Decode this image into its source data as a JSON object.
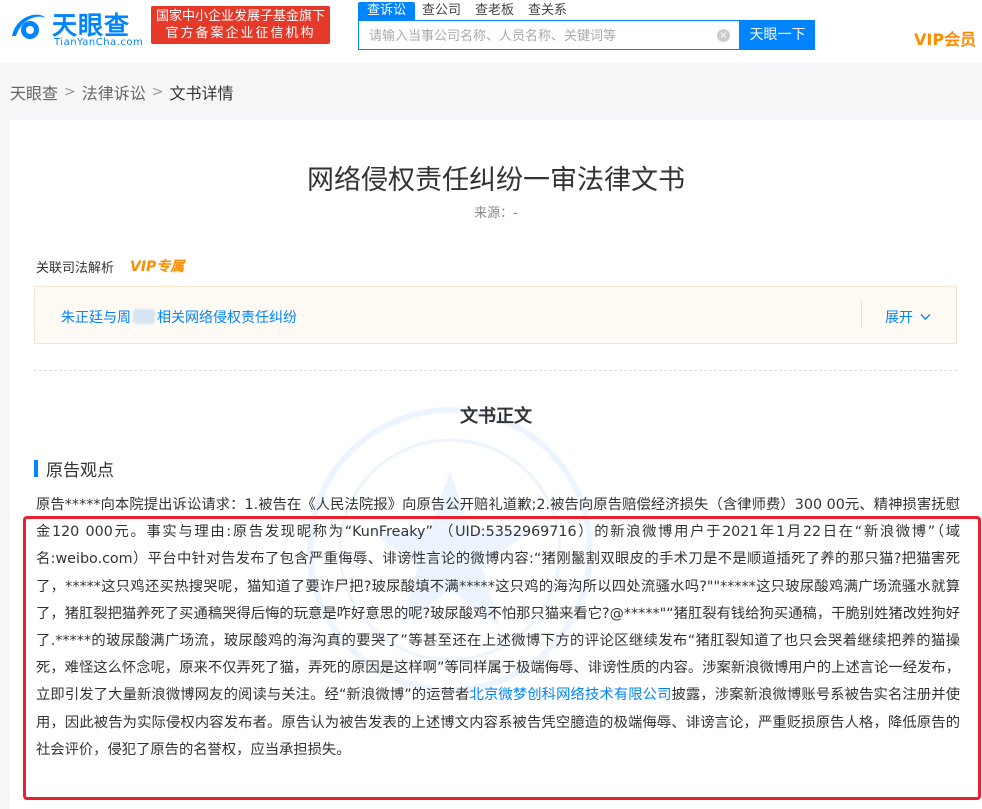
{
  "header": {
    "logo_cn": "天眼查",
    "logo_en": "TianYanCha.com",
    "gov_badge_line1": "国家中小企业发展子基金旗下",
    "gov_badge_line2": "官方备案企业征信机构",
    "search_tabs": [
      "查诉讼",
      "查公司",
      "查老板",
      "查关系"
    ],
    "search_placeholder": "请输入当事公司名称、人员名称、关键词等",
    "search_button": "天眼一下",
    "vip_label": "VIP会员"
  },
  "breadcrumb": {
    "items": [
      "天眼查",
      "法律诉讼",
      "文书详情"
    ],
    "separator": ">"
  },
  "document": {
    "title": "网络侵权责任纠纷一审法律文书",
    "source": "来源：-",
    "analysis_label": "关联司法解析",
    "vip_tag": "VIP专属",
    "related_case_part1": "朱正廷与周",
    "related_case_part2": "相关网络侵权责任纠纷",
    "expand_label": "展开",
    "section_title": "文书正文",
    "plaintiff_heading": "原告观点",
    "body_part1": "原告*****向本院提出诉讼请求：1.被告在《人民法院报》向原告公开赔礼道歉;2.被告向原告赔偿经济损失（含律师费）300 00元、精神损害抚慰金120 000元。事实与理由:原告发现昵称为“KunFreaky” （UID:5352969716）的新浪微博用户于2021年1月22日在“新浪微博”（域名:weibo.com）平台中针对告发布了包含严重侮辱、诽谤性言论的微博内容:“猪刚鬣割双眼皮的手术刀是不是顺道插死了养的那只猫?把猫害死了，*****这只鸡还买热搜哭呢，猫知道了要诈尸把?玻尿酸填不满*****这只鸡的海沟所以四处流骚水吗?\"\"*****这只玻尿酸鸡满广场流骚水就算了，猪肛裂把猫养死了买通稿哭得后悔的玩意是咋好意思的呢?玻尿酸鸡不怕那只猫来看它?@*****\"“猪肛裂有钱给狗买通稿，干脆别姓猪改姓狗好了.*****的玻尿酸满广场流，玻尿酸鸡的海沟真的要哭了”等甚至还在上述微博下方的评论区继续发布“猪肛裂知道了也只会哭着继续把养的猫操死，难怪这么怀念呢，原来不仅弄死了猫，弄死的原因是这样啊”等同样属于极端侮辱、诽谤性质的内容。涉案新浪微博用户的上述言论一经发布，立即引发了大量新浪微博网友的阅读与关注。经“新浪微博”的运营者",
    "body_link": "北京微梦创科网络技术有限公司",
    "body_part2": "披露，涉案新浪微博账号系被告实名注册并使用，因此被告为实际侵权内容发布者。原告认为被告发表的上述博文内容系被告凭空臆造的极端侮辱、诽谤言论，严重贬损原告人格，降低原告的社会评价，侵犯了原告的名誉权，应当承担损失。"
  },
  "colors": {
    "brand_blue": "#0084ff",
    "vip_orange": "#ff8c00",
    "gov_red": "#e5392a",
    "highlight_red": "#e8222d"
  },
  "icons": [
    "logo-eye-icon",
    "clear-icon",
    "chevron-down-icon"
  ]
}
